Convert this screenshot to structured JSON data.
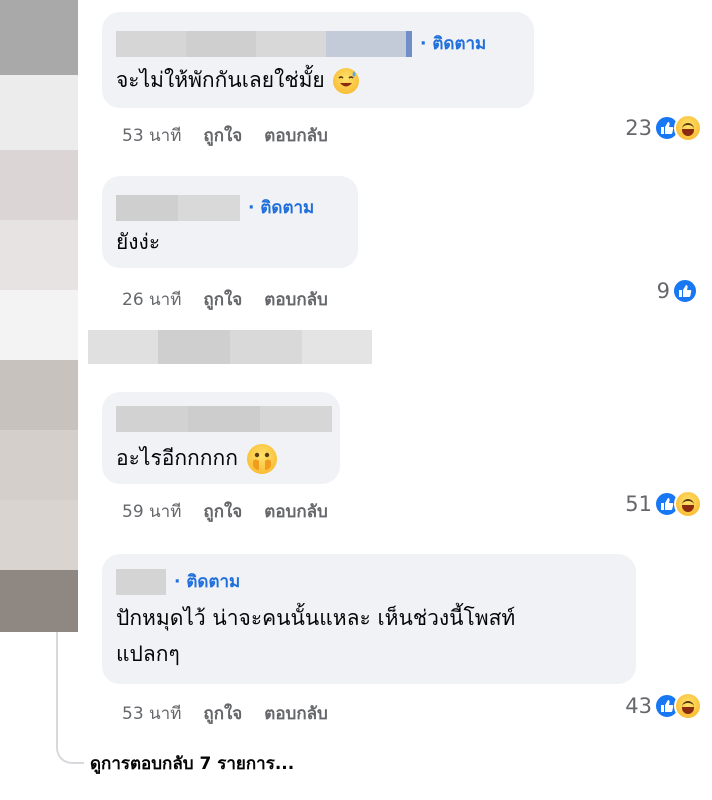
{
  "comments": [
    {
      "follow_label": "· ติดตาม",
      "text": "จะไม่ให้พักกันเลยใช่มั้ย",
      "emoji": "grinning-sweat-emoji",
      "time": "53 นาที",
      "like_action": "ถูกใจ",
      "reply_action": "ตอบกลับ",
      "reaction_count": "23",
      "reactions": [
        "like",
        "haha"
      ]
    },
    {
      "follow_label": "· ติดตาม",
      "text": "ยังง่ะ",
      "time": "26 นาที",
      "like_action": "ถูกใจ",
      "reply_action": "ตอบกลับ",
      "reaction_count": "9",
      "reactions": [
        "like"
      ]
    },
    {
      "text": "อะไรอีกกกกก",
      "emoji": "hand-over-mouth-emoji",
      "time": "59 นาที",
      "like_action": "ถูกใจ",
      "reply_action": "ตอบกลับ",
      "reaction_count": "51",
      "reactions": [
        "like",
        "haha"
      ]
    },
    {
      "follow_label": "· ติดตาม",
      "text_line1": "ปักหมุดไว้ น่าจะคนนั้นแหละ เห็นช่วงนี้โพสท์",
      "text_line2": "แปลกๆ",
      "time": "53 นาที",
      "like_action": "ถูกใจ",
      "reply_action": "ตอบกลับ",
      "reaction_count": "43",
      "reactions": [
        "like",
        "haha"
      ]
    }
  ],
  "view_more_replies": "ดูการตอบกลับ 7 รายการ...",
  "colors": {
    "bubble": "#f0f2f5",
    "follow_link": "#216fdb",
    "meta_text": "#65676b",
    "like_blue": "#1877f2"
  }
}
